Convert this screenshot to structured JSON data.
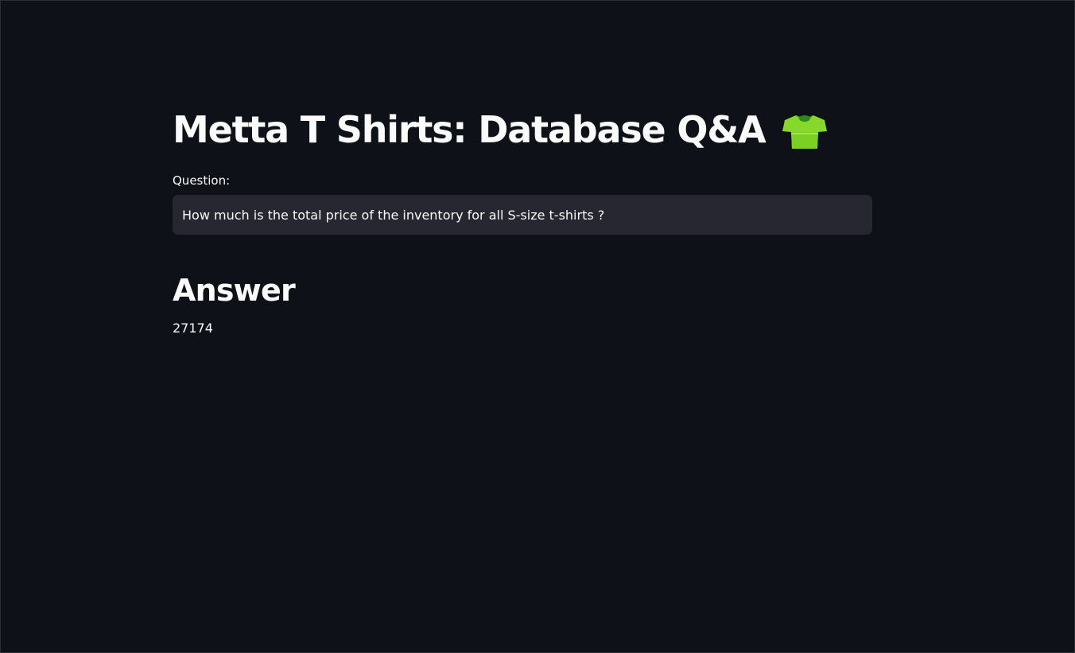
{
  "header": {
    "title": "Metta T Shirts: Database Q&A",
    "title_icon": "tshirt-icon"
  },
  "question": {
    "label": "Question:",
    "value": "How much is the total price of the inventory for all S-size t-shirts ?"
  },
  "answer": {
    "heading": "Answer",
    "value": "27174"
  },
  "colors": {
    "background": "#0e1117",
    "text": "#fafafa",
    "input_background": "#262730",
    "icon_green": "#7ed321"
  }
}
